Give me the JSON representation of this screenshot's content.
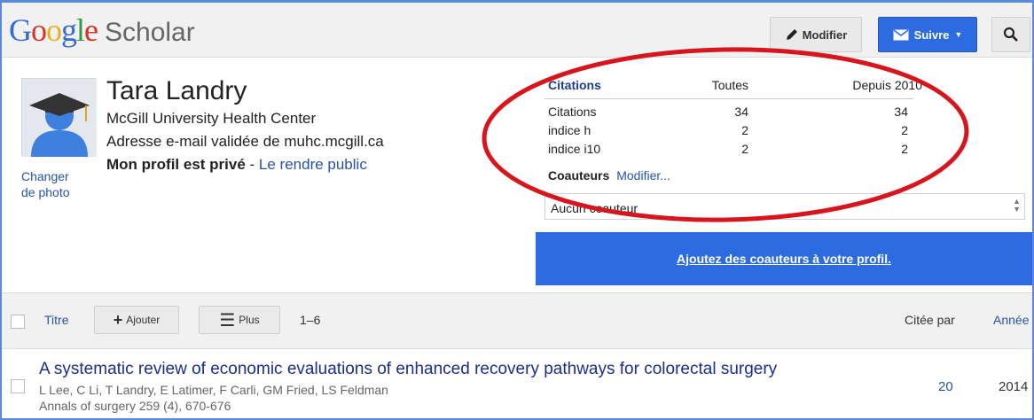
{
  "header": {
    "logo_google": "Google",
    "logo_scholar": "Scholar",
    "modify_label": "Modifier",
    "follow_label": "Suivre"
  },
  "profile": {
    "change_photo": "Changer de photo",
    "name": "Tara Landry",
    "affiliation": "McGill University Health Center",
    "email_verified": "Adresse e-mail validée de muhc.mcgill.ca",
    "privacy_status": "Mon profil est privé",
    "privacy_sep": " - ",
    "make_public_link": "Le rendre public"
  },
  "citations": {
    "header": {
      "label": "Citations",
      "all": "Toutes",
      "since": "Depuis 2010"
    },
    "rows": [
      {
        "label": "Citations",
        "all": "34",
        "since": "34"
      },
      {
        "label": "indice h",
        "all": "2",
        "since": "2"
      },
      {
        "label": "indice i10",
        "all": "2",
        "since": "2"
      }
    ]
  },
  "coauthors": {
    "title": "Coauteurs",
    "modify_link": "Modifier...",
    "empty_text": "Aucun coauteur"
  },
  "add_coauthors_banner": "Ajoutez des coauteurs à votre profil.",
  "toolbar": {
    "title_col": "Titre",
    "add_label": "Ajouter",
    "more_label": "Plus",
    "range": "1–6",
    "cited_by_col": "Citée par",
    "year_col": "Année"
  },
  "articles": [
    {
      "title": "A systematic review of economic evaluations of enhanced recovery pathways for colorectal surgery",
      "authors": "L Lee, C Li, T Landry, E Latimer, F Carli, GM Fried, LS Feldman",
      "venue": "Annals of surgery 259 (4), 670-676",
      "cited_by": "20",
      "year": "2014"
    }
  ],
  "colors": {
    "primary_blue": "#2d6ce0",
    "link_blue": "#2453a8",
    "annotation_red": "#d8141c"
  }
}
